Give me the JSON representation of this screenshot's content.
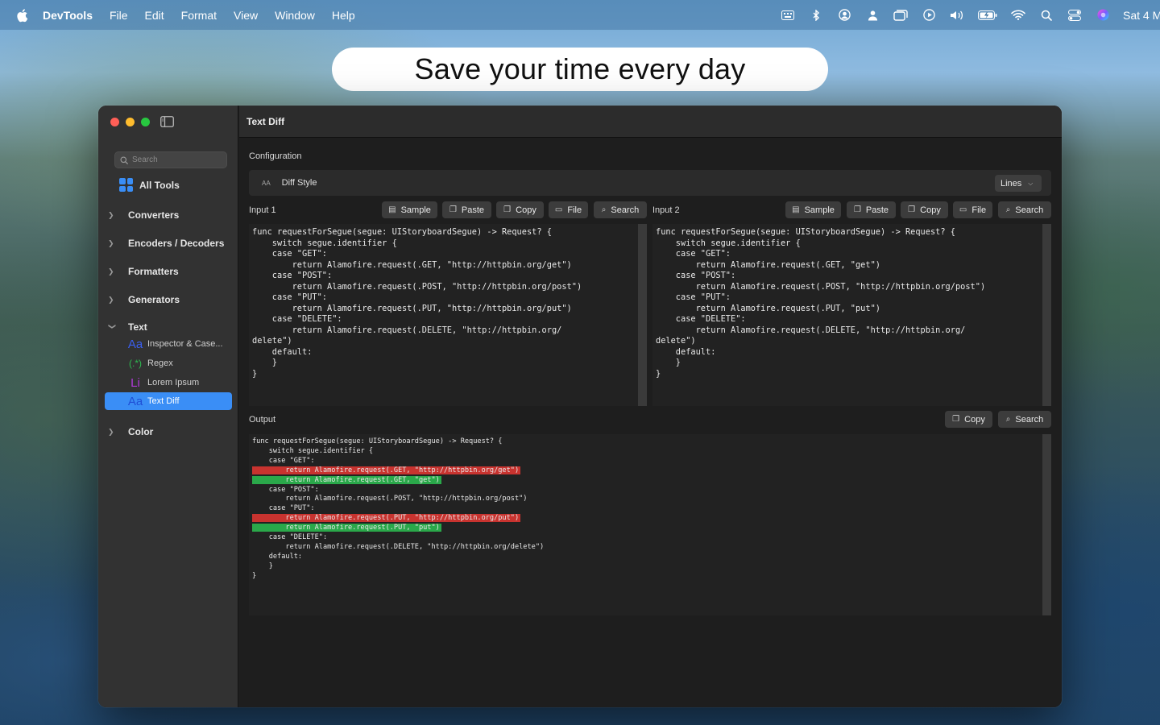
{
  "menubar": {
    "app_name": "DevTools",
    "items": [
      "File",
      "Edit",
      "Format",
      "View",
      "Window",
      "Help"
    ],
    "clock": "Sat 4 M"
  },
  "banner": {
    "text": "Save your time every day"
  },
  "window": {
    "title": "Text Diff"
  },
  "sidebar": {
    "search_placeholder": "Search",
    "all_tools": "All Tools",
    "groups": [
      {
        "label": "Converters",
        "expanded": false
      },
      {
        "label": "Encoders / Decoders",
        "expanded": false
      },
      {
        "label": "Formatters",
        "expanded": false
      },
      {
        "label": "Generators",
        "expanded": false
      },
      {
        "label": "Text",
        "expanded": true
      },
      {
        "label": "Color",
        "expanded": false
      }
    ],
    "text_items": [
      {
        "icon": "Aa",
        "label": "Inspector & Case...",
        "color": "#3a5ff0"
      },
      {
        "icon": "(.*)",
        "label": "Regex",
        "color": "#2db84f"
      },
      {
        "icon": "Li",
        "label": "Lorem Ipsum",
        "color": "#b03ad8"
      },
      {
        "icon": "Aa",
        "label": "Text Diff",
        "color": "#1f4fd6"
      }
    ]
  },
  "config": {
    "label": "Configuration",
    "diff_style_icon": "AA",
    "diff_style_label": "Diff Style",
    "diff_style_value": "Lines"
  },
  "input1": {
    "label": "Input 1",
    "buttons": [
      "Sample",
      "Paste",
      "Copy",
      "File",
      "Search"
    ],
    "text": "func requestForSegue(segue: UIStoryboardSegue) -> Request? {\n    switch segue.identifier {\n    case \"GET\":\n        return Alamofire.request(.GET, \"http://httpbin.org/get\")\n    case \"POST\":\n        return Alamofire.request(.POST, \"http://httpbin.org/post\")\n    case \"PUT\":\n        return Alamofire.request(.PUT, \"http://httpbin.org/put\")\n    case \"DELETE\":\n        return Alamofire.request(.DELETE, \"http://httpbin.org/\ndelete\")\n    default:\n    }\n}"
  },
  "input2": {
    "label": "Input 2",
    "buttons": [
      "Sample",
      "Paste",
      "Copy",
      "File",
      "Search"
    ],
    "text": "func requestForSegue(segue: UIStoryboardSegue) -> Request? {\n    switch segue.identifier {\n    case \"GET\":\n        return Alamofire.request(.GET, \"get\")\n    case \"POST\":\n        return Alamofire.request(.POST, \"http://httpbin.org/post\")\n    case \"PUT\":\n        return Alamofire.request(.PUT, \"put\")\n    case \"DELETE\":\n        return Alamofire.request(.DELETE, \"http://httpbin.org/\ndelete\")\n    default:\n    }\n}"
  },
  "output": {
    "label": "Output",
    "buttons": [
      "Copy",
      "Search"
    ],
    "lines": [
      {
        "t": "func requestForSegue(segue: UIStoryboardSegue) -> Request? {",
        "s": "same"
      },
      {
        "t": "    switch segue.identifier {",
        "s": "same"
      },
      {
        "t": "    case \"GET\":",
        "s": "same"
      },
      {
        "t": "        return Alamofire.request(.GET, \"http://httpbin.org/get\")",
        "s": "del"
      },
      {
        "t": "        return Alamofire.request(.GET, \"get\")",
        "s": "add"
      },
      {
        "t": "    case \"POST\":",
        "s": "same"
      },
      {
        "t": "        return Alamofire.request(.POST, \"http://httpbin.org/post\")",
        "s": "same"
      },
      {
        "t": "    case \"PUT\":",
        "s": "same"
      },
      {
        "t": "        return Alamofire.request(.PUT, \"http://httpbin.org/put\")",
        "s": "del"
      },
      {
        "t": "        return Alamofire.request(.PUT, \"put\")",
        "s": "add"
      },
      {
        "t": "    case \"DELETE\":",
        "s": "same"
      },
      {
        "t": "        return Alamofire.request(.DELETE, \"http://httpbin.org/delete\")",
        "s": "same"
      },
      {
        "t": "    default:",
        "s": "same"
      },
      {
        "t": "    }",
        "s": "same"
      },
      {
        "t": "}",
        "s": "same"
      }
    ]
  },
  "colors": {
    "accent": "#3a8ef6",
    "deleted": "#c8332f",
    "added": "#2aa84a"
  }
}
